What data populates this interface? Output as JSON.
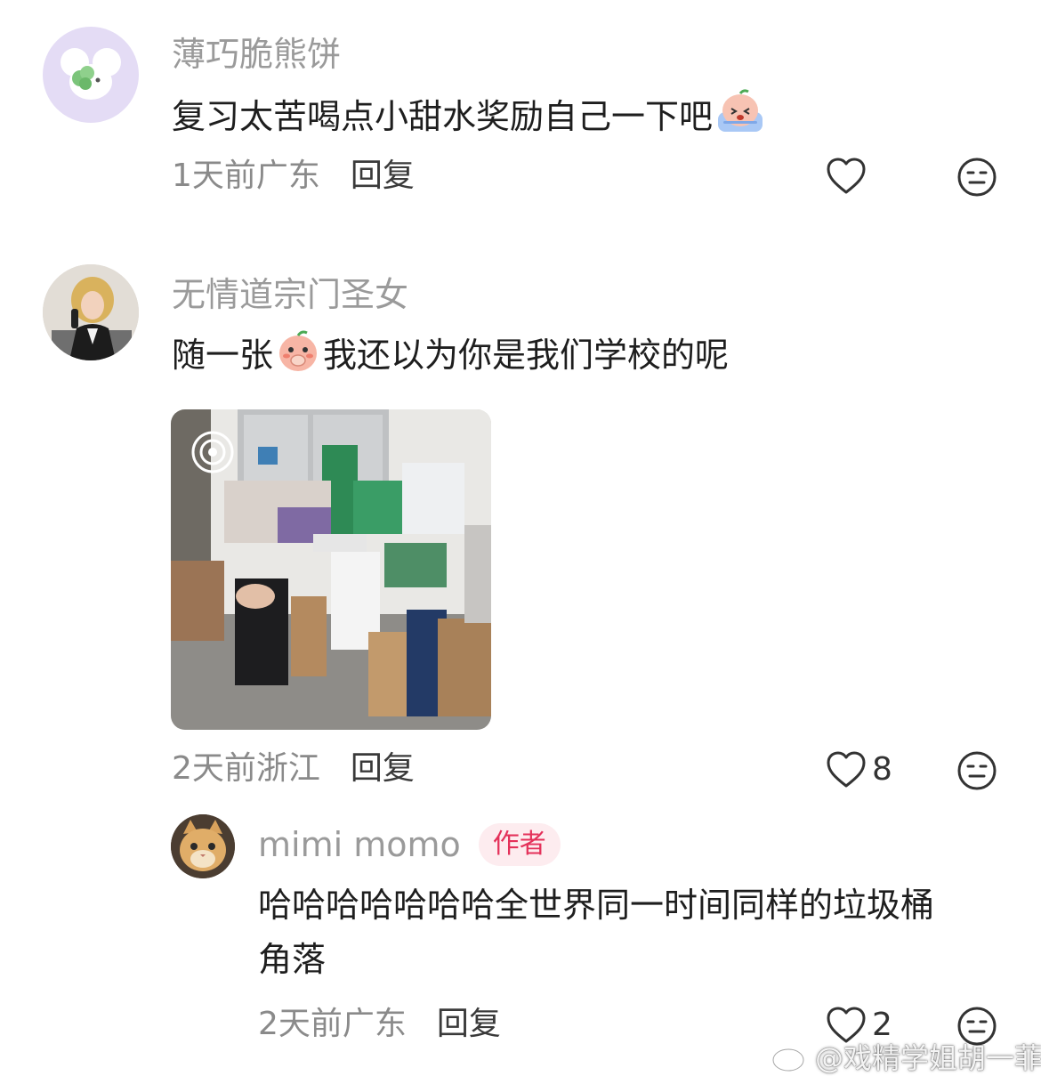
{
  "comments": [
    {
      "username": "薄巧脆熊饼",
      "text_before": "复习太苦喝点小甜水奖励自己一下吧",
      "emoji_icon": "crying-bun-emoji-icon",
      "time": "1天前",
      "location": "广东",
      "reply_label": "回复"
    },
    {
      "username": "无情道宗门圣女",
      "text_before": "随一张",
      "emoji_icon": "shy-bun-emoji-icon",
      "text_after": "我还以为你是我们学校的呢",
      "time": "2天前",
      "location": "浙江",
      "reply_label": "回复",
      "like_count": "8"
    }
  ],
  "reply_comment": {
    "username": "mimi momo",
    "badge": "作者",
    "text_line1": "哈哈哈哈哈哈哈全世界同一时间同样的垃圾桶",
    "text_line2": "角落",
    "time": "2天前",
    "location": "广东",
    "reply_label": "回复",
    "like_count": "2"
  },
  "watermark": "@戏精学姐胡一菲",
  "colors": {
    "author_badge_text": "#e4315a",
    "author_badge_bg": "#fdecef",
    "username": "#9a9a9a",
    "meta": "#8a8a8a"
  }
}
